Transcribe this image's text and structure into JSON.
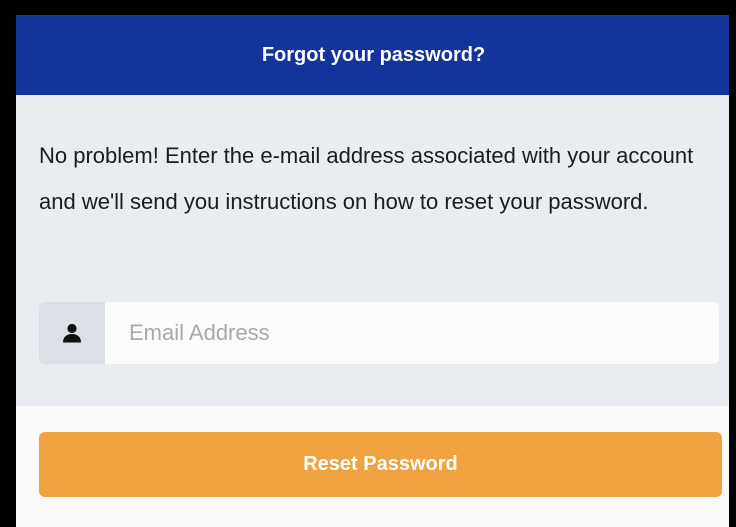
{
  "header": {
    "title": "Forgot your password?"
  },
  "body": {
    "instructions": "No problem! Enter the e-mail address associated with your account and we'll send you instructions on how to reset your password."
  },
  "email_field": {
    "icon": "user-icon",
    "placeholder": "Email Address",
    "value": ""
  },
  "footer": {
    "reset_label": "Reset Password"
  },
  "colors": {
    "header_bg": "#12349b",
    "button_bg": "#f0a140",
    "panel_bg": "#e9ecf0"
  }
}
